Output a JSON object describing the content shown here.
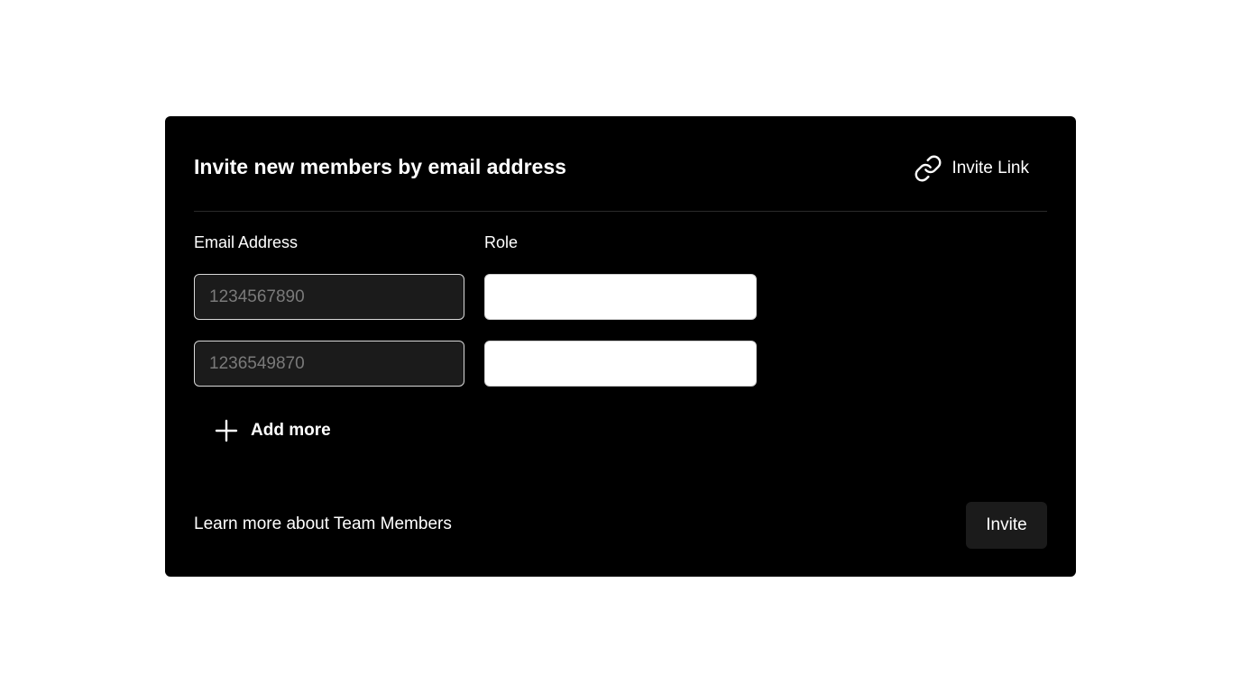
{
  "dialog": {
    "title": "Invite new members by email address",
    "invite_link_label": "Invite Link"
  },
  "form": {
    "email_column_label": "Email Address",
    "role_column_label": "Role",
    "rows": [
      {
        "email_placeholder": "1234567890",
        "email_value": "",
        "role_value": ""
      },
      {
        "email_placeholder": "1236549870",
        "email_value": "",
        "role_value": ""
      }
    ],
    "add_more_label": "Add more"
  },
  "footer": {
    "learn_more_label": "Learn more about Team Members",
    "invite_button_label": "Invite"
  },
  "icons": {
    "invite_link": "link-icon",
    "add_more": "plus-icon"
  },
  "colors": {
    "card_background": "#000000",
    "page_background": "#ffffff",
    "input_dark": "#1b1b1b",
    "button_background": "#1b1b1b",
    "placeholder_text": "#7a7a7a"
  }
}
